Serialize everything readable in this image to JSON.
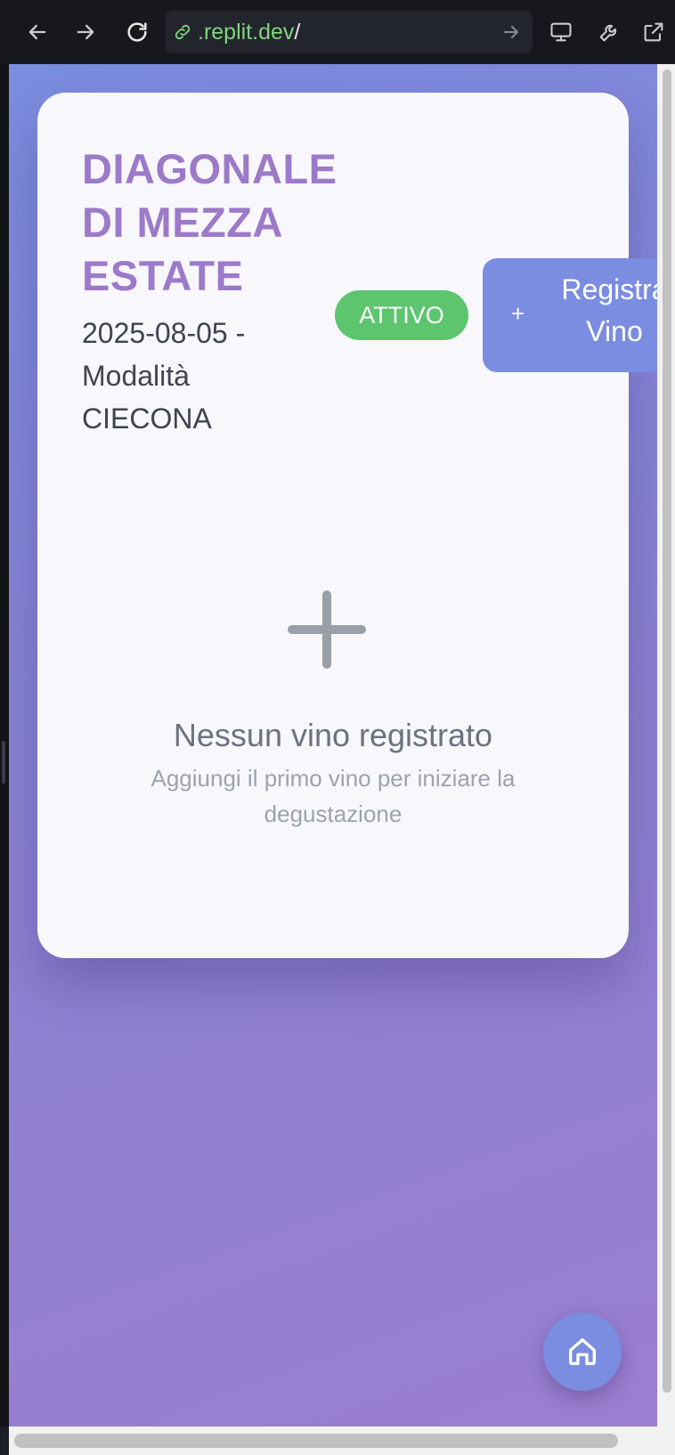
{
  "browser": {
    "url_domain": ".replit.dev",
    "url_path": "/",
    "icons": {
      "back": "arrow-left-icon",
      "forward": "arrow-right-icon",
      "reload": "reload-icon",
      "link": "link-icon",
      "go": "arrow-right-icon",
      "devices": "monitor-icon",
      "tools": "wrench-icon",
      "external": "external-link-icon"
    }
  },
  "session": {
    "title": "DIAGONALE DI MEZZA ESTATE",
    "subtitle": "2025-08-05 - Modalità CIECONA",
    "status": "ATTIVO",
    "register_plus": "+",
    "register_label": "Registra Vino"
  },
  "empty_state": {
    "title": "Nessun vino registrato",
    "description": "Aggiungi il primo vino per iniziare la degustazione",
    "icon": "plus-icon"
  },
  "fab": {
    "icon": "home-icon"
  },
  "colors": {
    "accent": "#7b8de0",
    "title": "#9c7ac9",
    "status": "#5cc56e"
  }
}
